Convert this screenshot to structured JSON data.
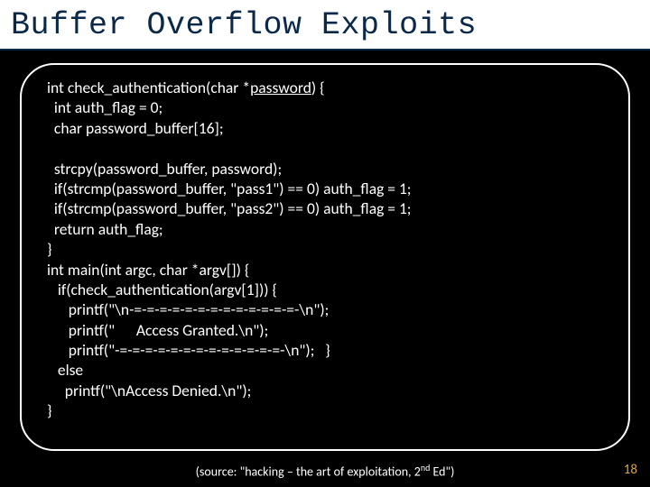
{
  "title": "Buffer Overflow Exploits",
  "code": {
    "l01a": "int check_authentication(char *",
    "l01b": "password",
    "l01c": ") {",
    "l02": "  int auth_flag = 0;",
    "l03": "  char password_buffer[16];",
    "l04": "",
    "l05": "  strcpy(password_buffer, password);",
    "l06": "  if(strcmp(password_buffer, \"pass1\") == 0) auth_flag = 1;",
    "l07": "  if(strcmp(password_buffer, \"pass2\") == 0) auth_flag = 1;",
    "l08": "  return auth_flag;",
    "l09": "}",
    "l10": "int main(int argc, char *argv[]) {",
    "l11": "   if(check_authentication(argv[1])) {",
    "l12": "      printf(\"\\n-=-=-=-=-=-=-=-=-=-=-=-=-=-\\n\");",
    "l13": "      printf(\"      Access Granted.\\n\");",
    "l14": "      printf(\"-=-=-=-=-=-=-=-=-=-=-=-=-=-\\n\");   }",
    "l15": "   else",
    "l16": "     printf(\"\\nAccess Denied.\\n\");",
    "l17": "}"
  },
  "source_prefix": "(source: \"hacking – the art of exploitation, 2",
  "source_sup": "nd",
  "source_suffix": " Ed\")",
  "page": "18"
}
